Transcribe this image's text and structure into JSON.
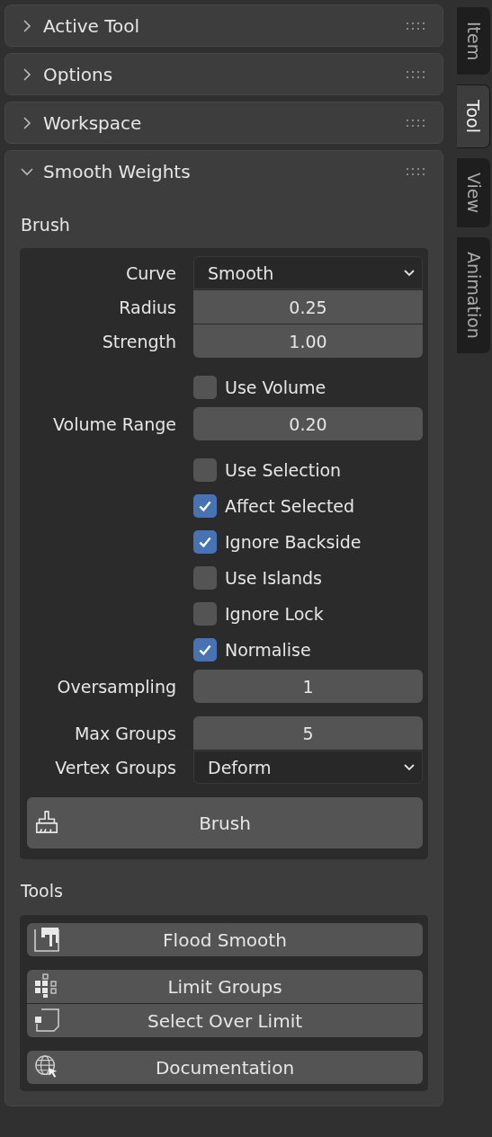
{
  "panels": [
    {
      "title": "Active Tool",
      "expanded": false
    },
    {
      "title": "Options",
      "expanded": false
    },
    {
      "title": "Workspace",
      "expanded": false
    },
    {
      "title": "Smooth Weights",
      "expanded": true
    }
  ],
  "brush": {
    "label": "Brush",
    "groups": [
      {
        "joined": true,
        "rows": [
          {
            "kind": "dropdown",
            "label": "Curve",
            "value": "Smooth"
          },
          {
            "kind": "number",
            "label": "Radius",
            "value": "0.25"
          },
          {
            "kind": "number",
            "label": "Strength",
            "value": "1.00"
          }
        ]
      },
      {
        "joined": false,
        "rows": [
          {
            "kind": "checkbox",
            "label": "Use Volume",
            "checked": false
          },
          {
            "kind": "number",
            "label": "Volume Range",
            "value": "0.20"
          }
        ]
      },
      {
        "joined": false,
        "rows": [
          {
            "kind": "checkbox",
            "label": "Use Selection",
            "checked": false
          },
          {
            "kind": "checkbox",
            "label": "Affect Selected",
            "checked": true
          },
          {
            "kind": "checkbox",
            "label": "Ignore Backside",
            "checked": true
          },
          {
            "kind": "checkbox",
            "label": "Use Islands",
            "checked": false
          },
          {
            "kind": "checkbox",
            "label": "Ignore Lock",
            "checked": false
          },
          {
            "kind": "checkbox",
            "label": "Normalise",
            "checked": true
          },
          {
            "kind": "number",
            "label": "Oversampling",
            "value": "1"
          }
        ]
      },
      {
        "joined": true,
        "rows": [
          {
            "kind": "number",
            "label": "Max Groups",
            "value": "5"
          },
          {
            "kind": "dropdown",
            "label": "Vertex Groups",
            "value": "Deform"
          }
        ]
      },
      {
        "joined": false,
        "rows": [
          {
            "kind": "button",
            "label": "Brush"
          }
        ]
      }
    ]
  },
  "tools": {
    "label": "Tools",
    "groups": [
      {
        "joined": false,
        "buttons": [
          "Flood Smooth"
        ]
      },
      {
        "joined": true,
        "buttons": [
          "Limit Groups",
          "Select Over Limit"
        ]
      },
      {
        "joined": false,
        "buttons": [
          "Documentation"
        ]
      }
    ]
  },
  "side_tabs": [
    {
      "label": "Item",
      "selected": false
    },
    {
      "label": "Tool",
      "selected": true
    },
    {
      "label": "View",
      "selected": false
    },
    {
      "label": "Animation",
      "selected": false
    }
  ]
}
